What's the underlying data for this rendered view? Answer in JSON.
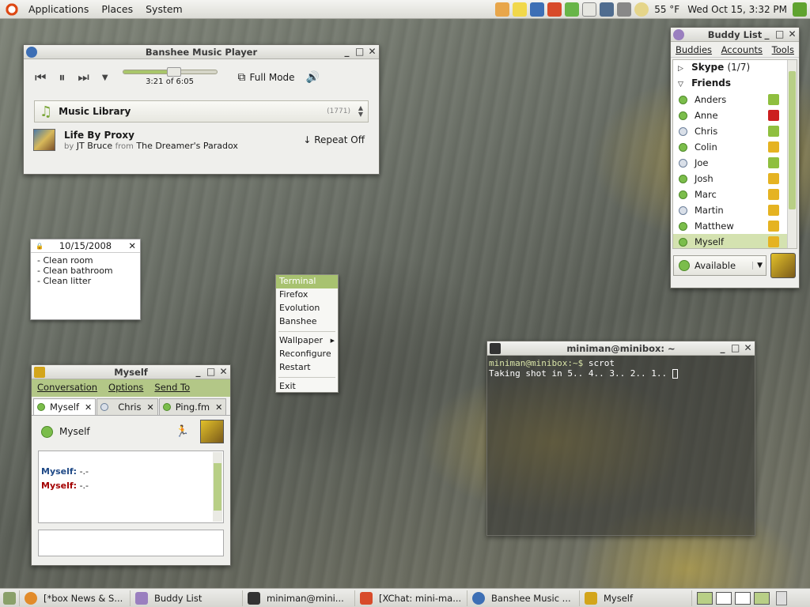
{
  "top_panel": {
    "menus": [
      "Applications",
      "Places",
      "System"
    ],
    "weather": "55 °F",
    "clock": "Wed Oct 15,  3:32 PM"
  },
  "banshee": {
    "title": "Banshee Music Player",
    "time": "3:21 of 6:05",
    "progress": 0.55,
    "full_mode": "Full Mode",
    "library": "Music Library",
    "library_count": "(1771)",
    "song": "Life By Proxy",
    "by": "by",
    "artist": "JT Bruce",
    "from": "from",
    "album": "The Dreamer's Paradox",
    "repeat": "Repeat Off"
  },
  "note": {
    "date": "10/15/2008",
    "items": [
      "- Clean room",
      "- Clean bathroom",
      "- Clean litter"
    ]
  },
  "context_menu": {
    "items": [
      "Terminal",
      "Firefox",
      "Evolution",
      "Banshee",
      "Wallpaper",
      "Reconfigure",
      "Restart",
      "Exit"
    ]
  },
  "buddy_list": {
    "title": "Buddy List",
    "menu": [
      "Buddies",
      "Accounts",
      "Tools"
    ],
    "group_skype": "Skype",
    "skype_count": "(1/7)",
    "group_friends": "Friends",
    "buddies": [
      "Anders",
      "Anne",
      "Chris",
      "Colin",
      "Joe",
      "Josh",
      "Marc",
      "Martin",
      "Matthew",
      "Myself"
    ],
    "status": "Available"
  },
  "conversation": {
    "title": "Myself",
    "menu": [
      "Conversation",
      "Options",
      "Send To"
    ],
    "tabs": [
      "Myself",
      "Chris",
      "Ping.fm"
    ],
    "header_name": "Myself",
    "messages": [
      {
        "user": "Myself:",
        "text": " -.-"
      },
      {
        "user": "Myself:",
        "text": " -.-"
      }
    ]
  },
  "terminal": {
    "title": "miniman@minibox: ~",
    "prompt": "miniman@minibox:~$",
    "command": " scrot",
    "output": "Taking shot in 5.. 4.. 3.. 2.. 1.. "
  },
  "taskbar": {
    "tasks": [
      "[*box News & S...",
      "Buddy List",
      "miniman@mini...",
      "[XChat: mini-ma...",
      "Banshee Music ...",
      "Myself"
    ]
  },
  "colors": {
    "accent_green": "#b8cf86",
    "online": "#7bbd4b"
  }
}
